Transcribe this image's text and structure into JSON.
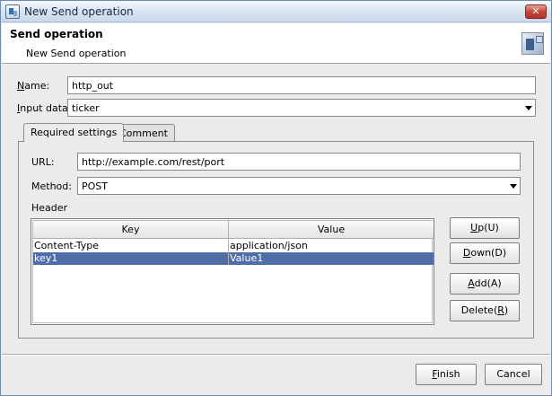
{
  "window": {
    "title": "New Send operation",
    "close_glyph": "✕"
  },
  "header": {
    "title": "Send operation",
    "subtitle": "New Send operation",
    "icon": "operation-wizard-icon"
  },
  "form": {
    "name_label_key": "N",
    "name_label_rest": "ame:",
    "name_value": "http_out",
    "input_label_key": "I",
    "input_label_rest": "nput data:",
    "input_value": "ticker"
  },
  "tabs": [
    {
      "label": "Required settings",
      "active": true
    },
    {
      "label": "Comment",
      "active": false
    }
  ],
  "settings": {
    "url_label": "URL:",
    "url_value": "http://example.com/rest/port",
    "method_label": "Method:",
    "method_value": "POST",
    "header_label": "Header"
  },
  "table": {
    "columns": [
      "Key",
      "Value"
    ],
    "rows": [
      {
        "key": "Content-Type",
        "value": "application/json",
        "selected": false
      },
      {
        "key": "key1",
        "value": "Value1",
        "selected": true
      }
    ]
  },
  "buttons": {
    "up_key": "U",
    "up_rest": "p(U)",
    "down_key": "D",
    "down_rest": "own(D)",
    "add_key": "A",
    "add_rest": "dd(A)",
    "delete_pre": "Delete(",
    "delete_key": "R",
    "delete_post": ")",
    "finish_key": "F",
    "finish_rest": "inish",
    "cancel_label": "Cancel"
  }
}
